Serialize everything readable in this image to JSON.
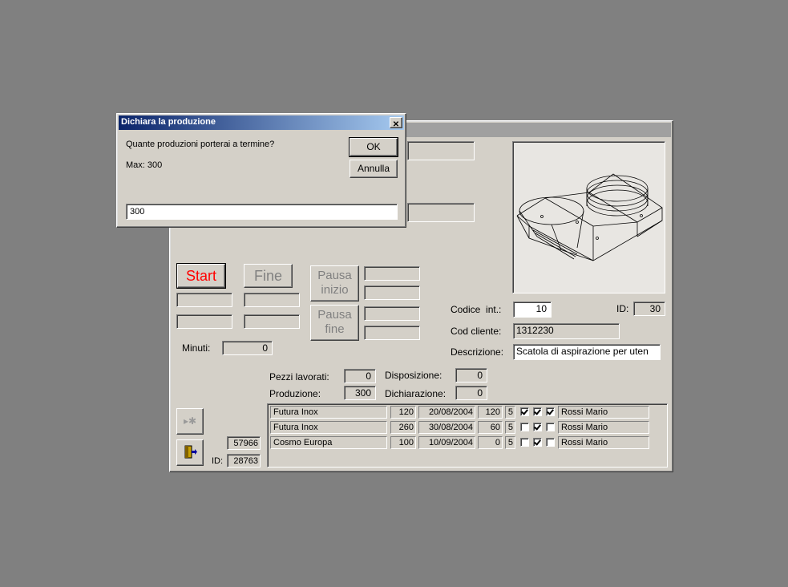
{
  "dialog": {
    "title": "Dichiara la produzione",
    "close_glyph": "✕",
    "question": "Quante produzioni porterai a termine?",
    "max_text": "Max: 300",
    "ok_label": "OK",
    "cancel_label": "Annulla",
    "input_value": "300"
  },
  "form": {
    "start_label": "Start",
    "fine_label": "Fine",
    "pausa_inizio_label": "Pausa inizio",
    "pausa_fine_label": "Pausa fine",
    "minuti_label": "Minuti:",
    "minuti_value": "0",
    "codice_int_label": "Codice  int.:",
    "codice_int_value": "10",
    "id_label": "ID:",
    "id_value": "30",
    "cod_cliente_label": "Cod cliente:",
    "cod_cliente_value": "1312230",
    "descrizione_label": "Descrizione:",
    "descrizione_value": "Scatola di aspirazione per uten",
    "pezzi_label": "Pezzi lavorati:",
    "pezzi_value": "0",
    "produzione_label": "Produzione:",
    "produzione_value": "300",
    "disposizione_label": "Disposizione:",
    "disposizione_value": "0",
    "dichiarazione_label": "Dichiarazione:",
    "dichiarazione_value": "0",
    "record_value": "57966",
    "bottom_id_label": "ID:",
    "bottom_id_value": "28763"
  },
  "rows": [
    {
      "client": "Futura Inox",
      "qty": "120",
      "date": "20/08/2004",
      "n1": "120",
      "n2": "5",
      "c1": true,
      "c2": true,
      "c3": true,
      "person": "Rossi Mario"
    },
    {
      "client": "Futura Inox",
      "qty": "260",
      "date": "30/08/2004",
      "n1": "60",
      "n2": "5",
      "c1": false,
      "c2": true,
      "c3": false,
      "person": "Rossi Mario"
    },
    {
      "client": "Cosmo Europa",
      "qty": "100",
      "date": "10/09/2004",
      "n1": "0",
      "n2": "5",
      "c1": false,
      "c2": true,
      "c3": false,
      "person": "Rossi Mario"
    }
  ]
}
